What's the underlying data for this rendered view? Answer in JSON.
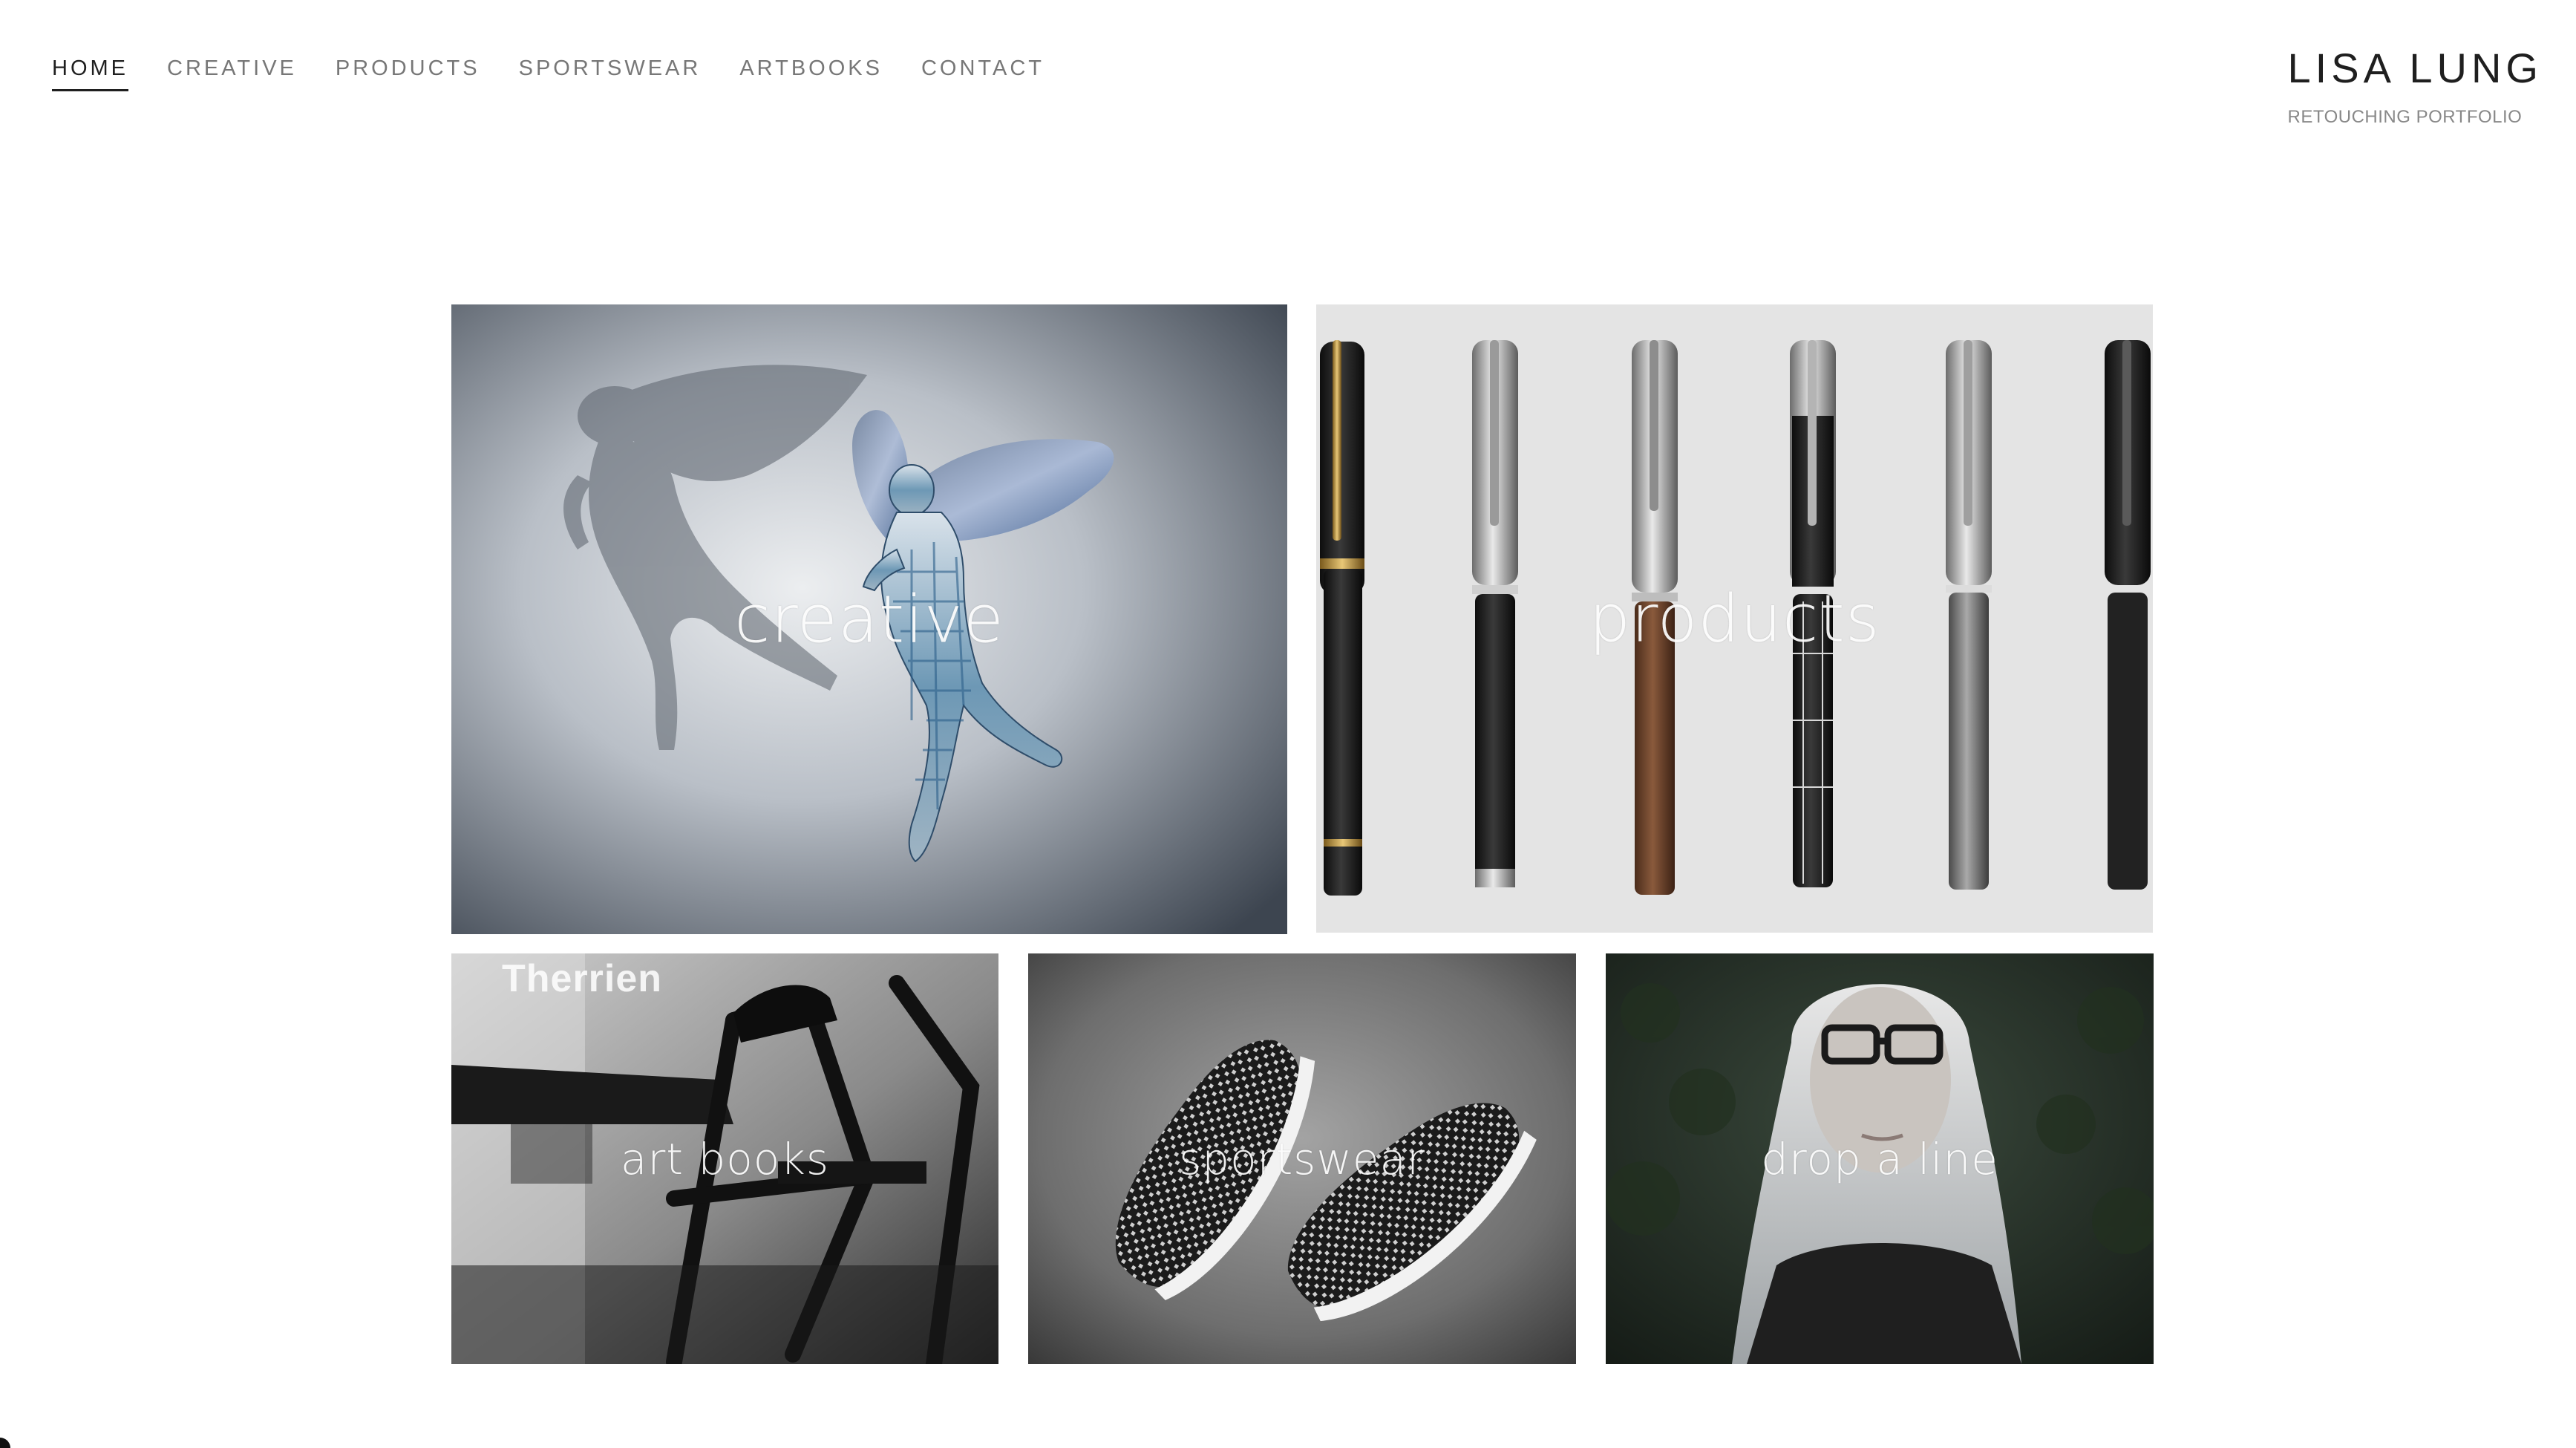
{
  "nav": {
    "items": [
      {
        "label": "HOME",
        "active": true
      },
      {
        "label": "CREATIVE",
        "active": false
      },
      {
        "label": "PRODUCTS",
        "active": false
      },
      {
        "label": "SPORTSWEAR",
        "active": false
      },
      {
        "label": "ARTBOOKS",
        "active": false
      },
      {
        "label": "CONTACT",
        "active": false
      }
    ]
  },
  "brand": {
    "title": "LISA LUNG",
    "subtitle": "RETOUCHING PORTFOLIO"
  },
  "gallery": {
    "tiles": [
      {
        "label": "creative",
        "image": "crystal-fairy-figurine-with-shadow"
      },
      {
        "label": "products",
        "image": "row-of-fountain-pens"
      },
      {
        "label": "art books",
        "image": "black-and-white-folding-chairs",
        "watermark": "Therrien"
      },
      {
        "label": "sportswear",
        "image": "pair-of-knit-running-shoes"
      },
      {
        "label": "drop a line",
        "image": "portrait-woman-long-grey-hair-glasses"
      }
    ]
  },
  "colors": {
    "text_dark": "#1f1f1f",
    "text_muted": "#777777",
    "background": "#ffffff"
  }
}
